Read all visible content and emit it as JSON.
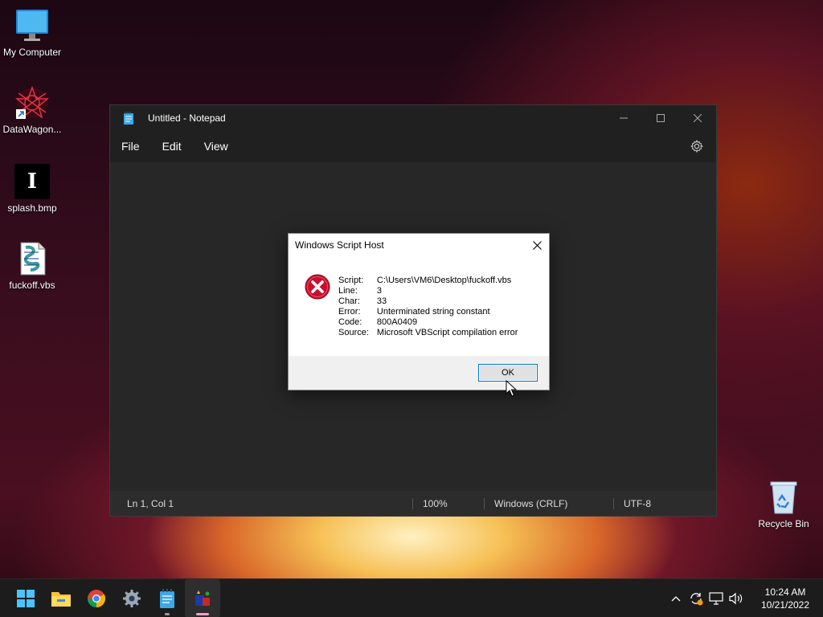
{
  "desktop": {
    "icons": [
      {
        "label": "My Computer",
        "icon": "monitor-icon"
      },
      {
        "label": "DataWagon...",
        "icon": "datawagon-shortcut-icon"
      },
      {
        "label": "splash.bmp",
        "icon": "bitmap-file-icon"
      },
      {
        "label": "fuckoff.vbs",
        "icon": "vbscript-file-icon"
      },
      {
        "label": "Recycle Bin",
        "icon": "recycle-bin-icon"
      }
    ],
    "splash_glyph": "I"
  },
  "notepad": {
    "title": "Untitled - Notepad",
    "menu": [
      "File",
      "Edit",
      "View"
    ],
    "status": {
      "position": "Ln 1, Col 1",
      "zoom": "100%",
      "line_ending": "Windows (CRLF)",
      "encoding": "UTF-8"
    }
  },
  "dialog": {
    "title": "Windows Script Host",
    "rows": [
      {
        "key": "Script:",
        "value": "C:\\Users\\VM6\\Desktop\\fuckoff.vbs"
      },
      {
        "key": "Line:",
        "value": "3"
      },
      {
        "key": "Char:",
        "value": "33"
      },
      {
        "key": "Error:",
        "value": "Unterminated string constant"
      },
      {
        "key": "Code:",
        "value": "800A0409"
      },
      {
        "key": "Source:",
        "value": "Microsoft VBScript compilation error"
      }
    ],
    "ok_label": "OK"
  },
  "taskbar": {
    "apps": [
      "start-icon",
      "file-explorer-icon",
      "chrome-icon",
      "settings-icon",
      "notepad-icon",
      "wsh-icon"
    ],
    "clock": {
      "time": "10:24 AM",
      "date": "10/21/2022"
    }
  },
  "colors": {
    "accent": "#0078d7",
    "error_red": "#c8102e"
  }
}
